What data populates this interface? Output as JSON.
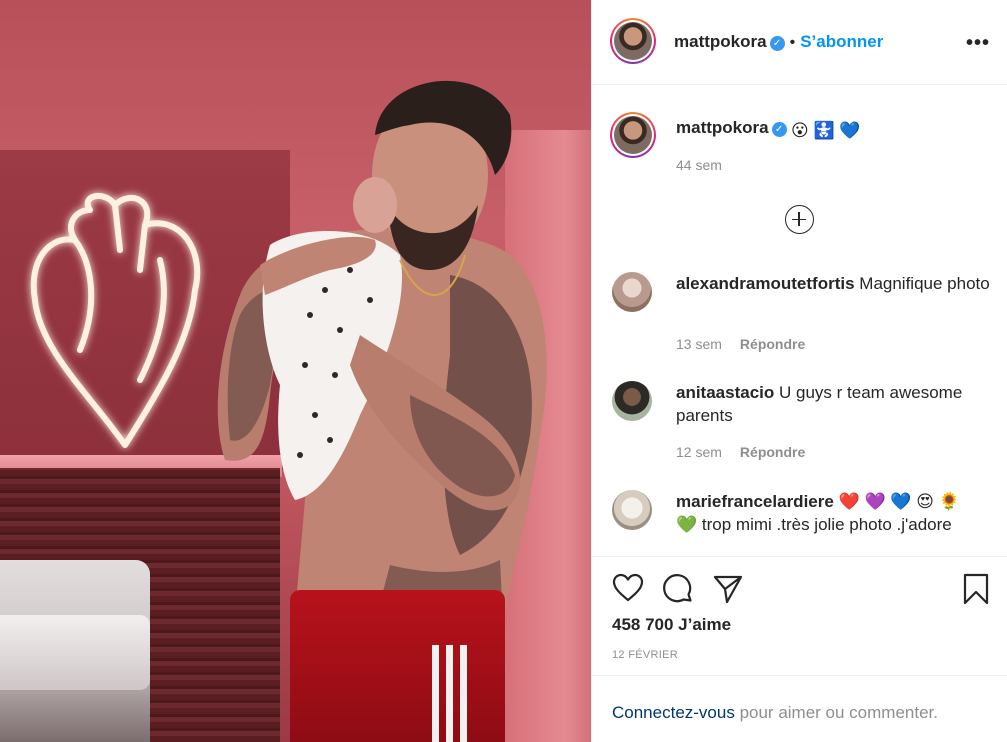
{
  "post": {
    "username": "mattpokora",
    "follow_label": "S’abonner",
    "more_label": "•••"
  },
  "caption": {
    "username": "mattpokora",
    "emojis": "😮 🚼 💙",
    "time": "44 sem"
  },
  "comments": [
    {
      "username": "alexandramoutetfortis",
      "text": "Magnifique photo",
      "time": "13 sem",
      "reply": "Répondre"
    },
    {
      "username": "anitaastacio",
      "text": "U guys r team awesome parents",
      "time": "12 sem",
      "reply": "Répondre"
    },
    {
      "username": "mariefrancelardiere",
      "emojis_start": "❤️ 💜 💙 😍 🌻",
      "text_line2": "💚 trop mimi .très jolie photo .j'adore"
    }
  ],
  "likes": "458 700 J’aime",
  "date": "12 FÉVRIER",
  "login": {
    "link": "Connectez-vous",
    "rest": " pour aimer ou commenter."
  },
  "colors": {
    "accent": "#0095f6",
    "text": "#262626",
    "muted": "#8e8e8e",
    "verified": "#3897f0"
  },
  "icons": [
    "heart-icon",
    "comment-icon",
    "share-icon",
    "bookmark-icon",
    "plus-circle-icon",
    "verified-icon",
    "more-icon"
  ]
}
